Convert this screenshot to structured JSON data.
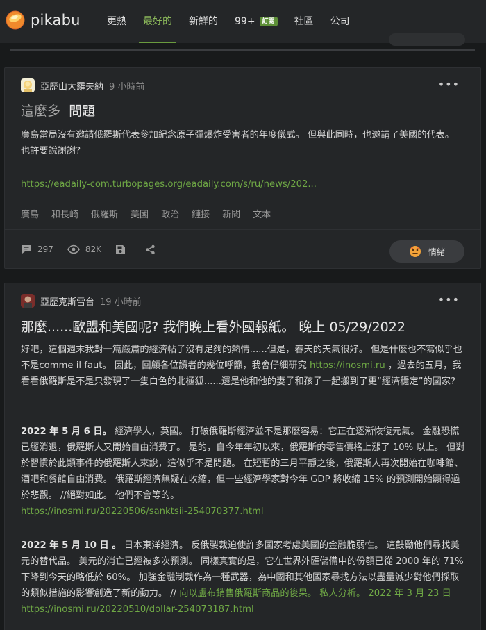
{
  "header": {
    "logo_text": "pikabu",
    "nav": [
      {
        "label": "更熱",
        "active": false
      },
      {
        "label": "最好的",
        "active": true
      },
      {
        "label": "新鮮的",
        "active": false
      },
      {
        "label": "99+",
        "badge": "訂閱",
        "active": false
      },
      {
        "label": "社區",
        "active": false
      },
      {
        "label": "公司",
        "active": false
      }
    ]
  },
  "post1": {
    "author": "亞歷山大羅夫納",
    "time": "9 小時前",
    "title_prefix": "這麼多",
    "title_main": "問題",
    "body": "廣島當局沒有邀請俄羅斯代表參加紀念原子彈爆炸受害者的年度儀式。 但與此同時，也邀請了美國的代表。 也許要說謝謝?",
    "link": "https://eadaily-com.turbopages.org/eadaily.com/s/ru/news/202...",
    "tags": [
      "廣島",
      "和長崎",
      "俄羅斯",
      "美國",
      "政治",
      "鏈接",
      "新聞",
      "文本"
    ],
    "comments": "297",
    "views": "82K",
    "emotion_label": "情緒"
  },
  "post2": {
    "author": "亞歷克斯雷台",
    "time": "19 小時前",
    "title": "那麼......歐盟和美國呢? 我們晚上看外國報紙。 晚上 05/29/2022",
    "intro_a": "好吧，這個週末我對一篇嚴肅的經濟帖子沒有足夠的熱情......但是，春天的天氣很好。 但是什麼也不寫似乎也不是comme il faut。 因此，回顧各位讀者的幾位呼籲，我會仔細研究 ",
    "intro_link": "https://inosmi.ru",
    "intro_b": " ，過去的五月，我看看俄羅斯是不是只發現了一隻白色的北極狐......還是他和他的妻子和孩子一起搬到了更“經濟穩定”的國家?",
    "p2_date": "2022 年 5 月 6 日。",
    "p2_text": " 經濟學人，英國。 打破俄羅斯經濟並不是那麼容易：它正在逐漸恢復元氣。 金融恐慌已經消退，俄羅斯人又開始自由消費了。 是的，自今年年初以來，俄羅斯的零售價格上漲了 10% 以上。 但對於習慣於此類事件的俄羅斯人來說，這似乎不是問題。 在短暫的三月平靜之後，俄羅斯人再次開始在咖啡館、酒吧和餐館自由消費。 俄羅斯經濟無疑在收縮，但一些經濟學家對今年 GDP 將收縮 15% 的預測開始顯得過於悲觀。 //絕對如此。 他們不會等的。",
    "p2_link": "https://inosmi.ru/20220506/sanktsii-254070377.html",
    "p3_date": "2022 年 5 月 10 日 。",
    "p3_text": " 日本東洋經濟。 反俄製裁迫使許多國家考慮美國的金融脆弱性。 這鼓勵他們尋找美元的替代品。 美元的消亡已經被多次預測。 同樣真實的是，它在世界外匯儲備中的份額已從 2000 年的 71% 下降到今天的略低於 60%。 加強金融制裁作為一種武器，為中國和其他國家尋找方法以盡量減少對他們採取的類似措施的影響創造了新的動力。 // ",
    "p3_link_text": "向以盧布銷售俄羅斯商品的後果。 私人分析。 2022 年 3 月 23 日",
    "p3_link2": "https://inosmi.ru/20220510/dollar-254073187.html"
  }
}
